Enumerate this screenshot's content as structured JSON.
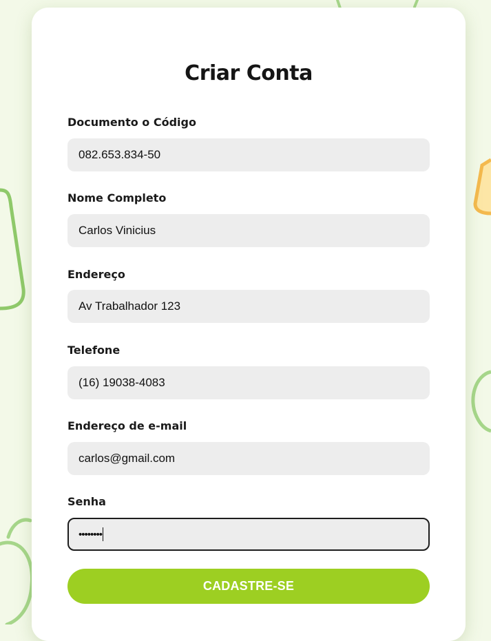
{
  "form": {
    "title": "Criar Conta",
    "fields": [
      {
        "label": "Documento o Código",
        "value": "082.653.834-50"
      },
      {
        "label": "Nome Completo",
        "value": "Carlos Vinicius"
      },
      {
        "label": "Endereço",
        "value": "Av Trabalhador 123"
      },
      {
        "label": "Telefone",
        "value": "(16) 19038-4083"
      },
      {
        "label": "Endereço de e-mail",
        "value": "carlos@gmail.com"
      },
      {
        "label": "Senha",
        "value": "••••••••"
      }
    ],
    "submit_label": "CADASTRE-SE"
  },
  "colors": {
    "accent": "#9dcf22",
    "background": "#f3f9e8",
    "input_bg": "#ededed"
  },
  "decorations": [
    "leaf-doodle-icon",
    "apple-doodle-icon",
    "lemon-doodle-icon",
    "circle-fruit-doodle-icon"
  ]
}
